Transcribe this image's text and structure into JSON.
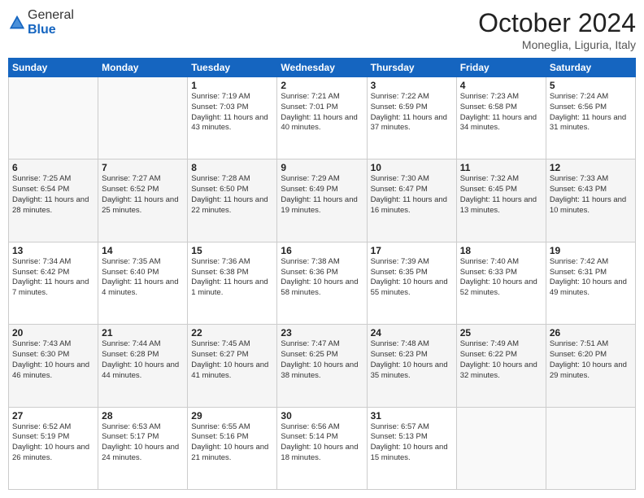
{
  "logo": {
    "general": "General",
    "blue": "Blue"
  },
  "header": {
    "month": "October 2024",
    "location": "Moneglia, Liguria, Italy"
  },
  "weekdays": [
    "Sunday",
    "Monday",
    "Tuesday",
    "Wednesday",
    "Thursday",
    "Friday",
    "Saturday"
  ],
  "weeks": [
    [
      {
        "day": "",
        "sunrise": "",
        "sunset": "",
        "daylight": ""
      },
      {
        "day": "",
        "sunrise": "",
        "sunset": "",
        "daylight": ""
      },
      {
        "day": "1",
        "sunrise": "Sunrise: 7:19 AM",
        "sunset": "Sunset: 7:03 PM",
        "daylight": "Daylight: 11 hours and 43 minutes."
      },
      {
        "day": "2",
        "sunrise": "Sunrise: 7:21 AM",
        "sunset": "Sunset: 7:01 PM",
        "daylight": "Daylight: 11 hours and 40 minutes."
      },
      {
        "day": "3",
        "sunrise": "Sunrise: 7:22 AM",
        "sunset": "Sunset: 6:59 PM",
        "daylight": "Daylight: 11 hours and 37 minutes."
      },
      {
        "day": "4",
        "sunrise": "Sunrise: 7:23 AM",
        "sunset": "Sunset: 6:58 PM",
        "daylight": "Daylight: 11 hours and 34 minutes."
      },
      {
        "day": "5",
        "sunrise": "Sunrise: 7:24 AM",
        "sunset": "Sunset: 6:56 PM",
        "daylight": "Daylight: 11 hours and 31 minutes."
      }
    ],
    [
      {
        "day": "6",
        "sunrise": "Sunrise: 7:25 AM",
        "sunset": "Sunset: 6:54 PM",
        "daylight": "Daylight: 11 hours and 28 minutes."
      },
      {
        "day": "7",
        "sunrise": "Sunrise: 7:27 AM",
        "sunset": "Sunset: 6:52 PM",
        "daylight": "Daylight: 11 hours and 25 minutes."
      },
      {
        "day": "8",
        "sunrise": "Sunrise: 7:28 AM",
        "sunset": "Sunset: 6:50 PM",
        "daylight": "Daylight: 11 hours and 22 minutes."
      },
      {
        "day": "9",
        "sunrise": "Sunrise: 7:29 AM",
        "sunset": "Sunset: 6:49 PM",
        "daylight": "Daylight: 11 hours and 19 minutes."
      },
      {
        "day": "10",
        "sunrise": "Sunrise: 7:30 AM",
        "sunset": "Sunset: 6:47 PM",
        "daylight": "Daylight: 11 hours and 16 minutes."
      },
      {
        "day": "11",
        "sunrise": "Sunrise: 7:32 AM",
        "sunset": "Sunset: 6:45 PM",
        "daylight": "Daylight: 11 hours and 13 minutes."
      },
      {
        "day": "12",
        "sunrise": "Sunrise: 7:33 AM",
        "sunset": "Sunset: 6:43 PM",
        "daylight": "Daylight: 11 hours and 10 minutes."
      }
    ],
    [
      {
        "day": "13",
        "sunrise": "Sunrise: 7:34 AM",
        "sunset": "Sunset: 6:42 PM",
        "daylight": "Daylight: 11 hours and 7 minutes."
      },
      {
        "day": "14",
        "sunrise": "Sunrise: 7:35 AM",
        "sunset": "Sunset: 6:40 PM",
        "daylight": "Daylight: 11 hours and 4 minutes."
      },
      {
        "day": "15",
        "sunrise": "Sunrise: 7:36 AM",
        "sunset": "Sunset: 6:38 PM",
        "daylight": "Daylight: 11 hours and 1 minute."
      },
      {
        "day": "16",
        "sunrise": "Sunrise: 7:38 AM",
        "sunset": "Sunset: 6:36 PM",
        "daylight": "Daylight: 10 hours and 58 minutes."
      },
      {
        "day": "17",
        "sunrise": "Sunrise: 7:39 AM",
        "sunset": "Sunset: 6:35 PM",
        "daylight": "Daylight: 10 hours and 55 minutes."
      },
      {
        "day": "18",
        "sunrise": "Sunrise: 7:40 AM",
        "sunset": "Sunset: 6:33 PM",
        "daylight": "Daylight: 10 hours and 52 minutes."
      },
      {
        "day": "19",
        "sunrise": "Sunrise: 7:42 AM",
        "sunset": "Sunset: 6:31 PM",
        "daylight": "Daylight: 10 hours and 49 minutes."
      }
    ],
    [
      {
        "day": "20",
        "sunrise": "Sunrise: 7:43 AM",
        "sunset": "Sunset: 6:30 PM",
        "daylight": "Daylight: 10 hours and 46 minutes."
      },
      {
        "day": "21",
        "sunrise": "Sunrise: 7:44 AM",
        "sunset": "Sunset: 6:28 PM",
        "daylight": "Daylight: 10 hours and 44 minutes."
      },
      {
        "day": "22",
        "sunrise": "Sunrise: 7:45 AM",
        "sunset": "Sunset: 6:27 PM",
        "daylight": "Daylight: 10 hours and 41 minutes."
      },
      {
        "day": "23",
        "sunrise": "Sunrise: 7:47 AM",
        "sunset": "Sunset: 6:25 PM",
        "daylight": "Daylight: 10 hours and 38 minutes."
      },
      {
        "day": "24",
        "sunrise": "Sunrise: 7:48 AM",
        "sunset": "Sunset: 6:23 PM",
        "daylight": "Daylight: 10 hours and 35 minutes."
      },
      {
        "day": "25",
        "sunrise": "Sunrise: 7:49 AM",
        "sunset": "Sunset: 6:22 PM",
        "daylight": "Daylight: 10 hours and 32 minutes."
      },
      {
        "day": "26",
        "sunrise": "Sunrise: 7:51 AM",
        "sunset": "Sunset: 6:20 PM",
        "daylight": "Daylight: 10 hours and 29 minutes."
      }
    ],
    [
      {
        "day": "27",
        "sunrise": "Sunrise: 6:52 AM",
        "sunset": "Sunset: 5:19 PM",
        "daylight": "Daylight: 10 hours and 26 minutes."
      },
      {
        "day": "28",
        "sunrise": "Sunrise: 6:53 AM",
        "sunset": "Sunset: 5:17 PM",
        "daylight": "Daylight: 10 hours and 24 minutes."
      },
      {
        "day": "29",
        "sunrise": "Sunrise: 6:55 AM",
        "sunset": "Sunset: 5:16 PM",
        "daylight": "Daylight: 10 hours and 21 minutes."
      },
      {
        "day": "30",
        "sunrise": "Sunrise: 6:56 AM",
        "sunset": "Sunset: 5:14 PM",
        "daylight": "Daylight: 10 hours and 18 minutes."
      },
      {
        "day": "31",
        "sunrise": "Sunrise: 6:57 AM",
        "sunset": "Sunset: 5:13 PM",
        "daylight": "Daylight: 10 hours and 15 minutes."
      },
      {
        "day": "",
        "sunrise": "",
        "sunset": "",
        "daylight": ""
      },
      {
        "day": "",
        "sunrise": "",
        "sunset": "",
        "daylight": ""
      }
    ]
  ]
}
